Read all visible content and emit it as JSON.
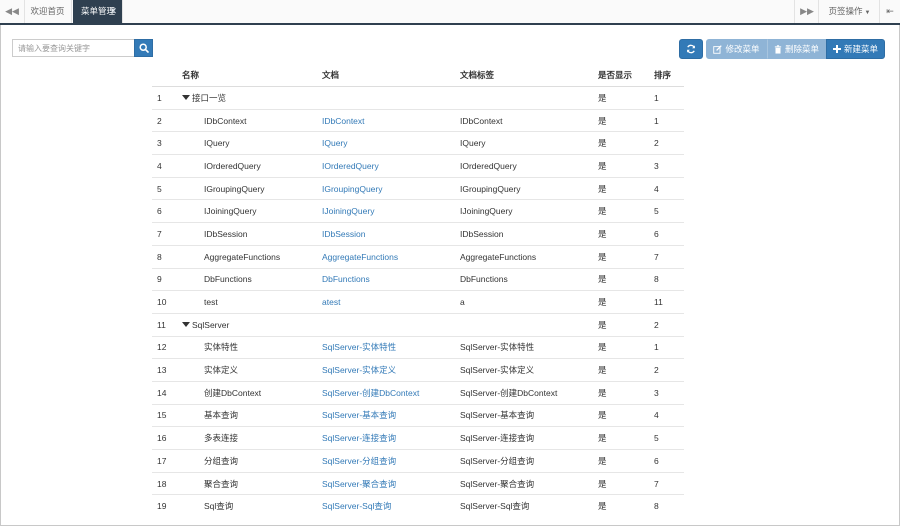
{
  "tabs": {
    "home": "欢迎首页",
    "active": "菜单管理",
    "page_ops": "页签操作"
  },
  "search": {
    "placeholder": "请输入要查询关键字"
  },
  "toolbar": {
    "edit": "修改菜单",
    "delete": "删除菜单",
    "new": "新建菜单"
  },
  "columns": {
    "name": "名称",
    "doc": "文档",
    "label": "文档标签",
    "show": "是否显示",
    "order": "排序"
  },
  "rows": [
    {
      "n": "1",
      "name": "接口一览",
      "doc": "",
      "label": "",
      "show": "是",
      "order": "1",
      "parent": true
    },
    {
      "n": "2",
      "name": "IDbContext",
      "doc": "IDbContext",
      "label": "IDbContext",
      "show": "是",
      "order": "1"
    },
    {
      "n": "3",
      "name": "IQuery",
      "doc": "IQuery",
      "label": "IQuery",
      "show": "是",
      "order": "2"
    },
    {
      "n": "4",
      "name": "IOrderedQuery",
      "doc": "IOrderedQuery",
      "label": "IOrderedQuery",
      "show": "是",
      "order": "3"
    },
    {
      "n": "5",
      "name": "IGroupingQuery",
      "doc": "IGroupingQuery",
      "label": "IGroupingQuery",
      "show": "是",
      "order": "4"
    },
    {
      "n": "6",
      "name": "IJoiningQuery",
      "doc": "IJoiningQuery",
      "label": "IJoiningQuery",
      "show": "是",
      "order": "5"
    },
    {
      "n": "7",
      "name": "IDbSession",
      "doc": "IDbSession",
      "label": "IDbSession",
      "show": "是",
      "order": "6"
    },
    {
      "n": "8",
      "name": "AggregateFunctions",
      "doc": "AggregateFunctions",
      "label": "AggregateFunctions",
      "show": "是",
      "order": "7"
    },
    {
      "n": "9",
      "name": "DbFunctions",
      "doc": "DbFunctions",
      "label": "DbFunctions",
      "show": "是",
      "order": "8"
    },
    {
      "n": "10",
      "name": "test",
      "doc": "atest",
      "label": "a",
      "show": "是",
      "order": "11"
    },
    {
      "n": "11",
      "name": "SqlServer",
      "doc": "",
      "label": "",
      "show": "是",
      "order": "2",
      "parent": true
    },
    {
      "n": "12",
      "name": "实体特性",
      "doc": "SqlServer-实体特性",
      "label": "SqlServer-实体特性",
      "show": "是",
      "order": "1"
    },
    {
      "n": "13",
      "name": "实体定义",
      "doc": "SqlServer-实体定义",
      "label": "SqlServer-实体定义",
      "show": "是",
      "order": "2"
    },
    {
      "n": "14",
      "name": "创建DbContext",
      "doc": "SqlServer-创建DbContext",
      "label": "SqlServer-创建DbContext",
      "show": "是",
      "order": "3"
    },
    {
      "n": "15",
      "name": "基本查询",
      "doc": "SqlServer-基本查询",
      "label": "SqlServer-基本查询",
      "show": "是",
      "order": "4"
    },
    {
      "n": "16",
      "name": "多表连接",
      "doc": "SqlServer-连接查询",
      "label": "SqlServer-连接查询",
      "show": "是",
      "order": "5"
    },
    {
      "n": "17",
      "name": "分组查询",
      "doc": "SqlServer-分组查询",
      "label": "SqlServer-分组查询",
      "show": "是",
      "order": "6"
    },
    {
      "n": "18",
      "name": "聚合查询",
      "doc": "SqlServer-聚合查询",
      "label": "SqlServer-聚合查询",
      "show": "是",
      "order": "7"
    },
    {
      "n": "19",
      "name": "Sql查询",
      "doc": "SqlServer-Sql查询",
      "label": "SqlServer-Sql查询",
      "show": "是",
      "order": "8"
    }
  ],
  "icons": {
    "tab_prev": "backward-icon",
    "tab_next": "forward-icon",
    "tab_close": "close-icon",
    "close_all": "logout-icon",
    "search": "search-icon",
    "refresh": "refresh-icon",
    "edit": "edit-icon",
    "delete": "trash-icon",
    "new": "plus-icon",
    "tree_toggle": "caret-down-icon"
  },
  "colors": {
    "accent": "#337ab7",
    "tab_active_bg": "#2f4050",
    "disabled_button": "#8fb4d6",
    "link": "#337ab7"
  }
}
